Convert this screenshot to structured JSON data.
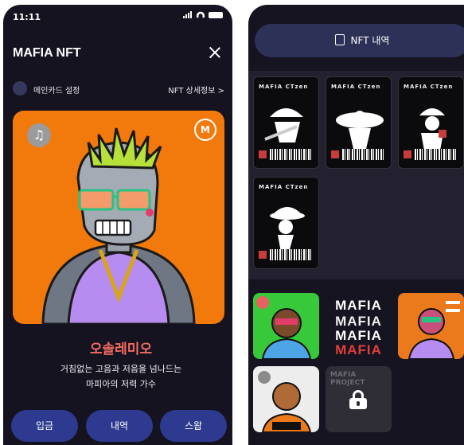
{
  "left": {
    "status": {
      "time": "11:11"
    },
    "header": {
      "title": "MAFIA NFT"
    },
    "main_card": {
      "label": "메인카드 설정",
      "detail_link": "NFT 상세정보 >"
    },
    "character": {
      "name": "오솔레미오",
      "desc_line1": "거침없는 고음과 저음을 넘나드는",
      "desc_line2": "마피아의 저력 가수"
    },
    "actions": {
      "deposit": "입금",
      "history": "내역",
      "swap": "스왑"
    }
  },
  "right": {
    "history_button": "NFT 내역",
    "cards": [
      {
        "title": "MAFIA CTzen"
      },
      {
        "title": "MAFIA CTzen"
      },
      {
        "title": "MAFIA CTzen"
      },
      {
        "title": "MAFIA CTzen"
      }
    ],
    "thumbnails": [
      {
        "kind": "character",
        "bg": "#38c93b"
      },
      {
        "kind": "text",
        "text": "MAFIA"
      },
      {
        "kind": "character",
        "bg": "#ea7a1c"
      },
      {
        "kind": "character",
        "bg": "#ededed"
      },
      {
        "kind": "locked",
        "text": "MAFIA PROJECT"
      }
    ]
  },
  "colors": {
    "bg_dark": "#15131f",
    "accent_button": "#2e3a8f",
    "art_bg": "#f27a0c",
    "name_color": "#f36b62"
  }
}
